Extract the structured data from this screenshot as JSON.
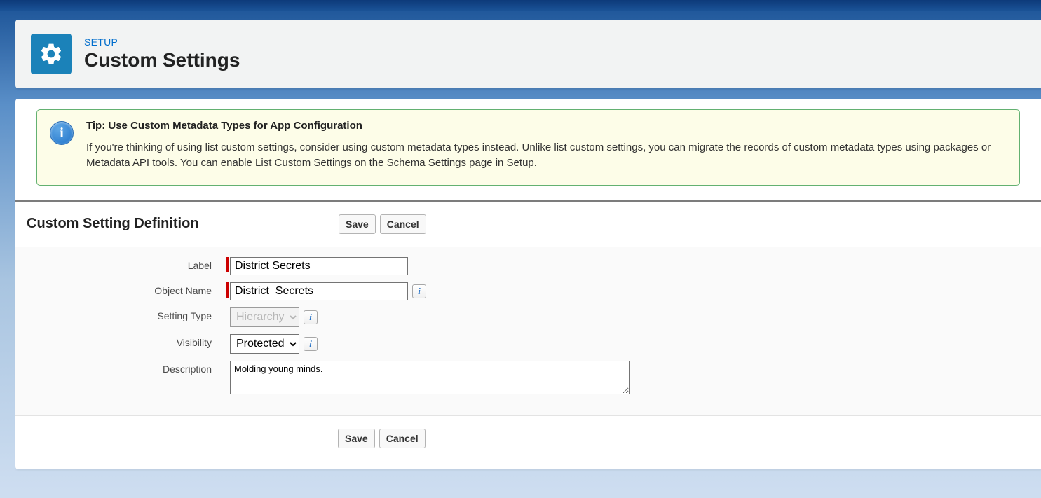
{
  "header": {
    "eyebrow": "SETUP",
    "title": "Custom Settings"
  },
  "tip": {
    "title": "Tip: Use Custom Metadata Types for App Configuration",
    "body": "If you're thinking of using list custom settings, consider using custom metadata types instead. Unlike list custom settings, you can migrate the records of custom metadata types using packages or Metadata API tools. You can enable List Custom Settings on the Schema Settings page in Setup."
  },
  "section": {
    "title": "Custom Setting Definition"
  },
  "buttons": {
    "save": "Save",
    "cancel": "Cancel"
  },
  "form": {
    "label": {
      "label": "Label",
      "value": "District Secrets"
    },
    "object_name": {
      "label": "Object Name",
      "value": "District_Secrets"
    },
    "setting_type": {
      "label": "Setting Type",
      "value": "Hierarchy"
    },
    "visibility": {
      "label": "Visibility",
      "value": "Protected"
    },
    "description": {
      "label": "Description",
      "value": "Molding young minds."
    }
  }
}
